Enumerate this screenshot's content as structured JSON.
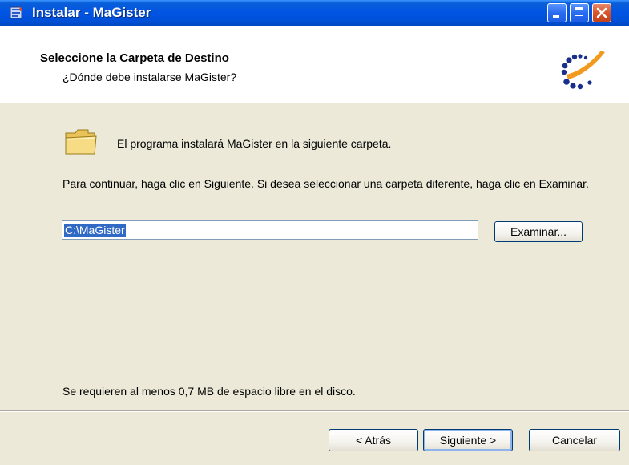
{
  "window": {
    "title": "Instalar - MaGister",
    "controls": [
      "minimize-icon",
      "maximize-icon",
      "close-icon"
    ]
  },
  "header": {
    "title": "Seleccione la Carpeta de Destino",
    "subtitle": "¿Dónde debe instalarse MaGister?",
    "logo_icon": "magister-logo"
  },
  "body": {
    "folder_icon": "folder-icon",
    "intro": "El programa instalará MaGister en la siguiente carpeta.",
    "instructions": "Para continuar, haga clic en Siguiente. Si desea seleccionar una carpeta diferente, haga clic en Examinar.",
    "path_value": "C:\\MaGister",
    "browse_label": "Examinar...",
    "space_required": "Se requieren al menos 0,7 MB de espacio libre en el disco."
  },
  "footer": {
    "back_label": "< Atrás",
    "next_label": "Siguiente >",
    "cancel_label": "Cancelar"
  },
  "colors": {
    "titlebar": "#0054e3",
    "dialog_bg": "#ece9d8",
    "selection": "#316ac5",
    "logo_blue": "#1a2e8c",
    "logo_orange": "#f29a1e"
  }
}
